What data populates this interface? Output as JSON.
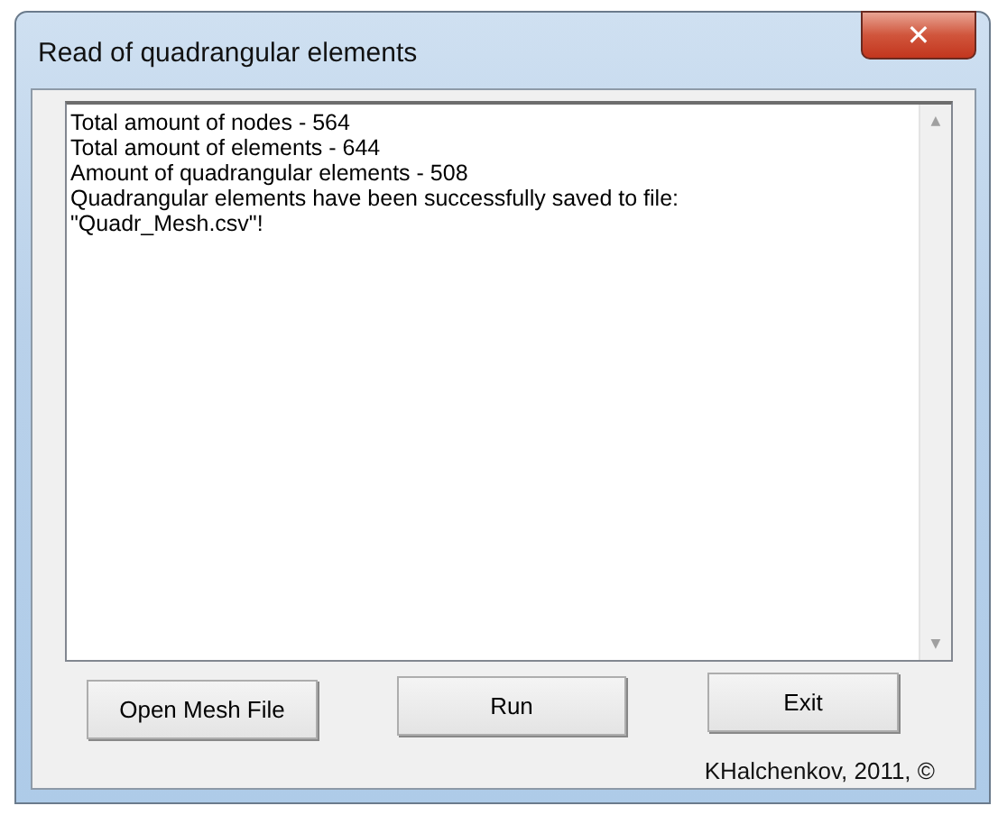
{
  "window": {
    "title": "Read of quadrangular elements",
    "close": "✕"
  },
  "log": {
    "lines": [
      "Total amount of nodes - 564",
      "Total amount of elements - 644",
      "Amount of quadrangular elements - 508",
      "Quadrangular elements have been successfully saved to file:",
      "\"Quadr_Mesh.csv\"!"
    ]
  },
  "scrollbar": {
    "up": "▲",
    "down": "▼"
  },
  "buttons": [
    "Open Mesh File",
    "Run",
    "Exit"
  ],
  "footer": "KHalchenkov, 2011, ©"
}
